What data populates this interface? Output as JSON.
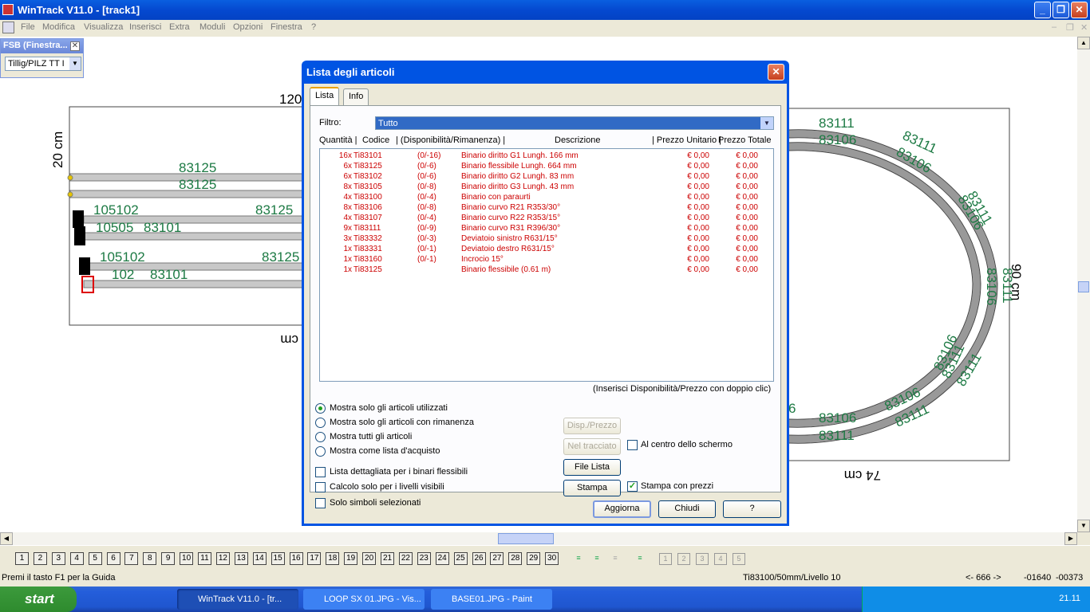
{
  "app": {
    "title": "WinTrack  V11.0 - [track1]"
  },
  "menu": [
    "File",
    "Modifica",
    "Visualizza",
    "Inserisci",
    "Extra",
    "Moduli",
    "Opzioni",
    "Finestra",
    "?"
  ],
  "fsb": {
    "title": "FSB (Finestra...",
    "select_value": "Tillig/PILZ  TT I"
  },
  "drawing": {
    "labels_left": [
      "120",
      "20 cm",
      "83125",
      "83125",
      "105102",
      "83125",
      "10505",
      "83101",
      "105102",
      "83125",
      "102",
      "83101",
      "cm"
    ],
    "labels_right": [
      "83111",
      "83106",
      "83111",
      "83106",
      "83111",
      "83106",
      "83111",
      "90 cm",
      "83106",
      "83111",
      "83106",
      "83111",
      "83106",
      "83111",
      "83106",
      "83111",
      "74 cm",
      "6"
    ]
  },
  "dialog": {
    "title": "Lista degli articoli",
    "tabs": [
      "Lista",
      "Info"
    ],
    "filter_label": "Filtro:",
    "filter_value": "Tutto",
    "columns": [
      "Quantità |",
      "Codice",
      "| (Disponibilità/Rimanenza) |",
      "Descrizione",
      "| Prezzo Unitario |",
      "Prezzo Totale"
    ],
    "rows": [
      {
        "qty": "16x",
        "code": "Ti83101",
        "avail": "(0/-16)",
        "desc": "Binario diritto G1 Lungh. 166 mm",
        "unit": "€ 0,00",
        "total": "€ 0,00"
      },
      {
        "qty": "6x",
        "code": "Ti83125",
        "avail": "(0/-6)",
        "desc": "Binario flessibile Lungh. 664 mm",
        "unit": "€ 0,00",
        "total": "€ 0,00"
      },
      {
        "qty": "6x",
        "code": "Ti83102",
        "avail": "(0/-6)",
        "desc": "Binario diritto G2 Lungh. 83 mm",
        "unit": "€ 0,00",
        "total": "€ 0,00"
      },
      {
        "qty": "8x",
        "code": "Ti83105",
        "avail": "(0/-8)",
        "desc": "Binario diritto G3 Lungh. 43 mm",
        "unit": "€ 0,00",
        "total": "€ 0,00"
      },
      {
        "qty": "4x",
        "code": "Ti83100",
        "avail": "(0/-4)",
        "desc": "Binario con paraurti",
        "unit": "€ 0,00",
        "total": "€ 0,00"
      },
      {
        "qty": "8x",
        "code": "Ti83106",
        "avail": "(0/-8)",
        "desc": "Binario curvo R21 R353/30°",
        "unit": "€ 0,00",
        "total": "€ 0,00"
      },
      {
        "qty": "4x",
        "code": "Ti83107",
        "avail": "(0/-4)",
        "desc": "Binario curvo R22 R353/15°",
        "unit": "€ 0,00",
        "total": "€ 0,00"
      },
      {
        "qty": "9x",
        "code": "Ti83111",
        "avail": "(0/-9)",
        "desc": "Binario curvo R31 R396/30°",
        "unit": "€ 0,00",
        "total": "€ 0,00"
      },
      {
        "qty": "3x",
        "code": "Ti83332",
        "avail": "(0/-3)",
        "desc": "Deviatoio sinistro R631/15°",
        "unit": "€ 0,00",
        "total": "€ 0,00"
      },
      {
        "qty": "1x",
        "code": "Ti83331",
        "avail": "(0/-1)",
        "desc": "Deviatoio destro R631/15°",
        "unit": "€ 0,00",
        "total": "€ 0,00"
      },
      {
        "qty": "1x",
        "code": "Ti83160",
        "avail": "(0/-1)",
        "desc": "Incrocio 15°",
        "unit": "€ 0,00",
        "total": "€ 0,00"
      },
      {
        "qty": "1x",
        "code": "Ti83125",
        "avail": "",
        "desc": "Binario flessibile (0.61 m)",
        "unit": "€ 0,00",
        "total": "€ 0,00"
      }
    ],
    "hint": "(Inserisci Disponibilità/Prezzo con doppio clic)",
    "radios": [
      {
        "label": "Mostra solo gli articoli utilizzati",
        "checked": true
      },
      {
        "label": "Mostra solo gli articoli con rimanenza",
        "checked": false
      },
      {
        "label": "Mostra tutti gli articoli",
        "checked": false
      },
      {
        "label": "Mostra come lista d'acquisto",
        "checked": false
      }
    ],
    "checks": [
      {
        "label": "Lista dettagliata per i binari flessibili",
        "checked": false
      },
      {
        "label": "Calcolo solo per i livelli visibili",
        "checked": false
      },
      {
        "label": "Solo simboli selezionati",
        "checked": false
      }
    ],
    "btn_disp": "Disp./Prezzo",
    "btn_tracciato": "Nel tracciato",
    "chk_centro": "Al centro dello schermo",
    "btn_filelista": "File Lista",
    "btn_stampa": "Stampa",
    "chk_prezzi": "Stampa con prezzi",
    "btn_aggiorna": "Aggiorna",
    "btn_chiudi": "Chiudi",
    "btn_help": "?"
  },
  "levels": [
    "1",
    "2",
    "3",
    "4",
    "5",
    "6",
    "7",
    "8",
    "9",
    "10",
    "11",
    "12",
    "13",
    "14",
    "15",
    "16",
    "17",
    "18",
    "19",
    "20",
    "21",
    "22",
    "23",
    "24",
    "25",
    "26",
    "27",
    "28",
    "29",
    "30"
  ],
  "levels_extra": [
    "1",
    "2",
    "3",
    "4",
    "5"
  ],
  "status": {
    "help": "Premi il tasto F1 per la Guida",
    "info": "Ti83100/50mm/Livello 10",
    "pos": "<- 666 ->",
    "x": "-01640",
    "y": "-00373"
  },
  "taskbar": {
    "start": "start",
    "tasks": [
      "WinTrack  V11.0 - [tr...",
      "LOOP SX 01.JPG - Vis...",
      "BASE01.JPG - Paint"
    ],
    "clock": "21.11"
  }
}
